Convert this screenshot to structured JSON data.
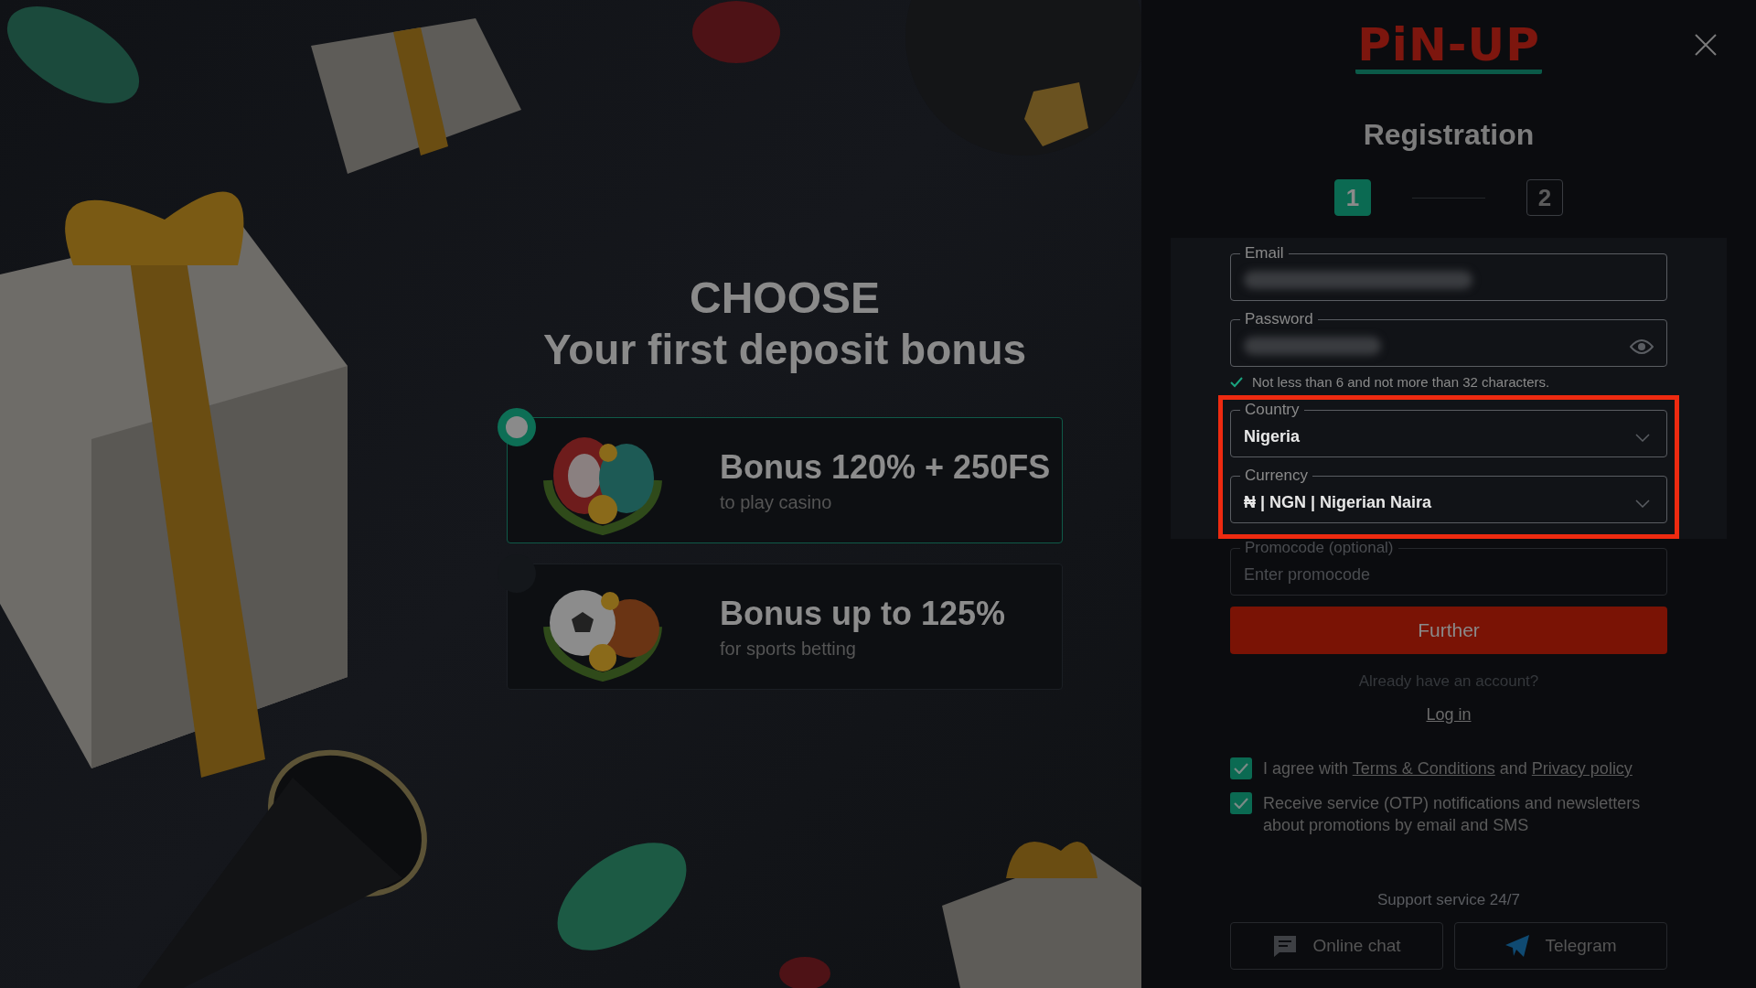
{
  "promo": {
    "heading": "CHOOSE",
    "subheading": "Your first deposit bonus"
  },
  "bonuses": [
    {
      "kind": "casino",
      "title": "Bonus 120% + 250FS",
      "subtitle": "to play casino",
      "selected": true
    },
    {
      "kind": "sports",
      "title": "Bonus up to 125%",
      "subtitle": "for sports betting",
      "selected": false
    }
  ],
  "logo": "PiN-UP",
  "title": "Registration",
  "steps": [
    {
      "label": "1",
      "selected": true
    },
    {
      "label": "2",
      "selected": false
    }
  ],
  "form": {
    "email": {
      "label": "Email"
    },
    "password": {
      "label": "Password"
    },
    "password_hint": {
      "text": "Not less than 6 and not more than 32 characters.",
      "valid": true
    },
    "selects": {
      "highlighted": true,
      "items": [
        {
          "label": "Country",
          "value": "Nigeria"
        },
        {
          "label": "Currency",
          "value": "₦ | NGN | Nigerian Naira"
        }
      ]
    },
    "promocode": {
      "label": "Promocode (optional)",
      "placeholder": "Enter promocode"
    },
    "submit": "Further"
  },
  "login_prompt": "Already have an account?",
  "login_link": "Log in",
  "consents": [
    {
      "checked": true,
      "parts": [
        {
          "text": "I agree with ",
          "link": false
        },
        {
          "text": "Terms & Conditions",
          "link": true
        },
        {
          "text": " and ",
          "link": false
        },
        {
          "text": "Privacy policy",
          "link": true
        }
      ]
    },
    {
      "checked": true,
      "parts": [
        {
          "text": "Receive service (OTP) notifications and newsletters about promotions by email and SMS",
          "link": false
        }
      ]
    }
  ],
  "support": {
    "title": "Support service 24/7",
    "buttons": [
      {
        "kind": "chat",
        "label": "Online chat"
      },
      {
        "kind": "telegram",
        "label": "Telegram"
      }
    ]
  }
}
